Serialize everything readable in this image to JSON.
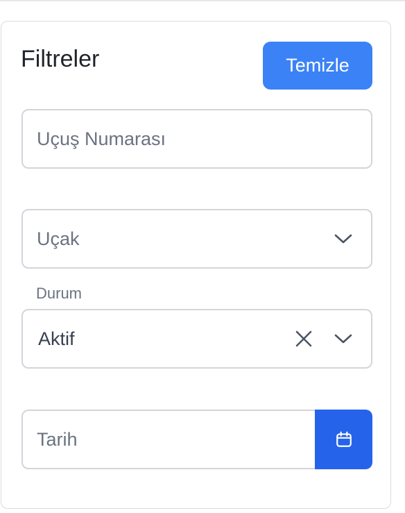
{
  "filters": {
    "title": "Filtreler",
    "clear_label": "Temizle",
    "flight_number": {
      "placeholder": "Uçuş Numarası",
      "value": ""
    },
    "aircraft": {
      "placeholder": "Uçak"
    },
    "status": {
      "label": "Durum",
      "value": "Aktif"
    },
    "date": {
      "placeholder": "Tarih",
      "value": ""
    }
  },
  "icons": {
    "chevron": "chevron-down-icon",
    "clear": "close-icon",
    "calendar": "calendar-icon"
  },
  "colors": {
    "primary": "#3b82f6",
    "primary_dark": "#2563eb",
    "border": "#d3d5da",
    "text": "#1f2329",
    "muted": "#6b7280"
  }
}
